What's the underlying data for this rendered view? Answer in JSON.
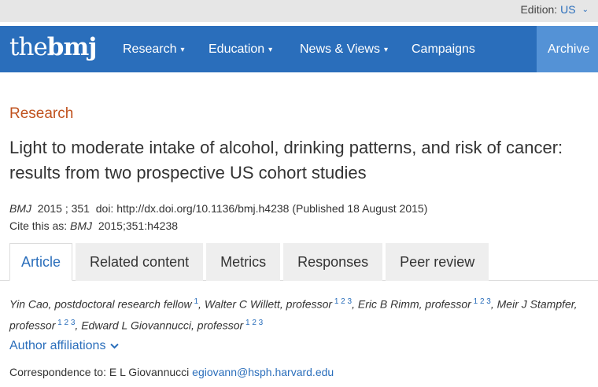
{
  "edition": {
    "label": "Edition:",
    "value": "US"
  },
  "logo": {
    "part1": "the",
    "part2": "bmj"
  },
  "nav": {
    "research": "Research",
    "education": "Education",
    "news_views": "News & Views",
    "campaigns": "Campaigns",
    "archive": "Archive"
  },
  "article": {
    "section": "Research",
    "title": "Light to moderate intake of alcohol, drinking patterns, and risk of cancer: results from two prospective US cohort studies",
    "journal": "BMJ",
    "year": "2015",
    "volume": "351",
    "doi_label": "doi:",
    "doi": "http://dx.doi.org/10.1136/bmj.h4238",
    "published": "(Published 18 August 2015)",
    "cite_label": "Cite this as:",
    "cite_journal": "BMJ",
    "cite_ref": "2015;351:h4238"
  },
  "tabs": [
    "Article",
    "Related content",
    "Metrics",
    "Responses",
    "Peer review"
  ],
  "authors": [
    {
      "name": "Yin Cao, postdoctoral research fellow",
      "sup": "1"
    },
    {
      "name": "Walter C Willett, professor",
      "sup": "1 2 3"
    },
    {
      "name": "Eric B Rimm, professor",
      "sup": "1 2 3"
    },
    {
      "name": "Meir J Stampfer, professor",
      "sup": "1 2 3"
    },
    {
      "name": "Edward L Giovannucci, professor",
      "sup": "1 2 3"
    }
  ],
  "affiliations_label": "Author affiliations",
  "correspondence": {
    "label": "Correspondence to: E L Giovannucci",
    "email": "egiovann@hsph.harvard.edu"
  },
  "colors": {
    "brand_blue": "#2a6ebb",
    "archive_blue": "#5492d6",
    "section_orange": "#c0521e"
  },
  "icons": {
    "dropdown": "chevron-down-icon"
  }
}
